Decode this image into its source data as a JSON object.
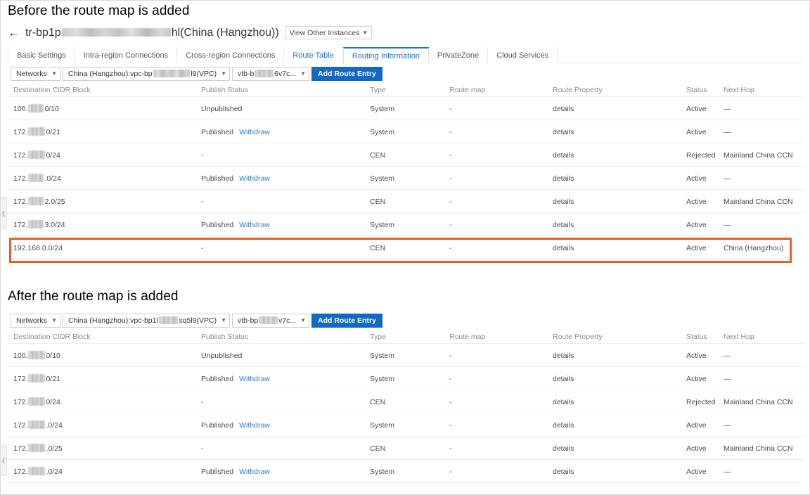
{
  "captions": {
    "before": "Before the route map is added",
    "after": "After the route map is added"
  },
  "header": {
    "back_icon": "arrow-left-icon",
    "title_prefix": "tr-bp1p",
    "title_suffix": "hl(China (Hangzhou))",
    "view_other_instances": "View Other Instances",
    "caret_icon": "chevron-down-icon"
  },
  "tabs": [
    {
      "label": "Basic Settings",
      "state": "normal"
    },
    {
      "label": "Intra-region Connections",
      "state": "normal"
    },
    {
      "label": "Cross-region Connections",
      "state": "normal"
    },
    {
      "label": "Route Table",
      "state": "link"
    },
    {
      "label": "Routing Information",
      "state": "active"
    },
    {
      "label": "PrivateZone",
      "state": "normal"
    },
    {
      "label": "Cloud Services",
      "state": "normal"
    }
  ],
  "filterbar_before": {
    "networks_select": "Networks",
    "vpc_select_prefix": "China (Hangzhou):vpc-bp",
    "vpc_select_suffix": "l9(VPC)",
    "vtb_select_prefix": "vtb-b",
    "vtb_select_suffix": "6v7c...",
    "add_route_entry": "Add Route Entry"
  },
  "filterbar_after": {
    "networks_select": "Networks",
    "vpc_select_prefix": "China (Hangzhou):vpc-bp1l",
    "vpc_select_suffix": "sq5l9(VPC)",
    "vtb_select_prefix": "vtb-bp",
    "vtb_select_suffix": "v7c...",
    "add_route_entry": "Add Route Entry"
  },
  "table_columns": {
    "cidr": "Destination CIDR Block",
    "publish": "Publish Status",
    "type": "Type",
    "route_map": "Route map",
    "route_property": "Route Property",
    "status": "Status",
    "next_hop": "Next Hop"
  },
  "colors": {
    "accent_blue": "#1268c3",
    "link_blue": "#2c7bd4",
    "highlight_orange": "#f05a28",
    "border_grey": "#ededed"
  },
  "table_before": {
    "rows": [
      {
        "cidr_prefix": "100.",
        "cidr_suffix": "0/10",
        "redact_w": 22,
        "publish": "Unpublished",
        "withdraw": "",
        "type": "System",
        "route_map": "-",
        "route_property": "details",
        "status": "Active",
        "next_hop": "—",
        "next_hop_link": true
      },
      {
        "cidr_prefix": "172.",
        "cidr_suffix": "0/21",
        "redact_w": 24,
        "publish": "Published",
        "withdraw": "Withdraw",
        "type": "System",
        "route_map": "-",
        "route_property": "details",
        "status": "Active",
        "next_hop": "—",
        "next_hop_link": true
      },
      {
        "cidr_prefix": "172.",
        "cidr_suffix": "0/24",
        "redact_w": 24,
        "publish": "-",
        "withdraw": "",
        "type": "CEN",
        "route_map": "-",
        "route_property": "details",
        "status": "Rejected",
        "next_hop": "Mainland China CCN",
        "next_hop_link": true
      },
      {
        "cidr_prefix": "172.",
        "cidr_suffix": ".0/24",
        "redact_w": 22,
        "publish": "Published",
        "withdraw": "Withdraw",
        "type": "System",
        "route_map": "-",
        "route_property": "details",
        "status": "Active",
        "next_hop": "—",
        "next_hop_link": true
      },
      {
        "cidr_prefix": "172.",
        "cidr_suffix": "2.0/25",
        "redact_w": 22,
        "publish": "-",
        "withdraw": "",
        "type": "CEN",
        "route_map": "-",
        "route_property": "details",
        "status": "Active",
        "next_hop": "Mainland China CCN",
        "next_hop_link": true
      },
      {
        "cidr_prefix": "172.",
        "cidr_suffix": "3.0/24",
        "redact_w": 22,
        "publish": "Published",
        "withdraw": "Withdraw",
        "type": "System",
        "route_map": "-",
        "route_property": "details",
        "status": "Active",
        "next_hop": "—",
        "next_hop_link": true
      },
      {
        "cidr_prefix": "192.168.0.0/24",
        "cidr_suffix": "",
        "redact_w": 0,
        "publish": "-",
        "withdraw": "",
        "type": "CEN",
        "route_map": "-",
        "route_property": "details",
        "status": "Active",
        "next_hop": "China (Hangzhou)",
        "next_hop_link": true,
        "highlighted": true
      }
    ]
  },
  "table_after": {
    "rows": [
      {
        "cidr_prefix": "100.",
        "cidr_suffix": "0/10",
        "redact_w": 24,
        "publish": "Unpublished",
        "withdraw": "",
        "type": "System",
        "route_map": "-",
        "route_property": "details",
        "status": "Active",
        "next_hop": "—",
        "next_hop_link": true
      },
      {
        "cidr_prefix": "172.",
        "cidr_suffix": "0/21",
        "redact_w": 24,
        "publish": "Published",
        "withdraw": "Withdraw",
        "type": "System",
        "route_map": "-",
        "route_property": "details",
        "status": "Active",
        "next_hop": "—",
        "next_hop_link": true
      },
      {
        "cidr_prefix": "172.",
        "cidr_suffix": "0/24",
        "redact_w": 24,
        "publish": "-",
        "withdraw": "",
        "type": "CEN",
        "route_map": "-",
        "route_property": "details",
        "status": "Rejected",
        "next_hop": "Mainland China CCN",
        "next_hop_link": true
      },
      {
        "cidr_prefix": "172.",
        "cidr_suffix": ".0/24",
        "redact_w": 24,
        "publish": "Published",
        "withdraw": "Withdraw",
        "type": "System",
        "route_map": "-",
        "route_property": "details",
        "status": "Active",
        "next_hop": "—",
        "next_hop_link": true
      },
      {
        "cidr_prefix": "172.",
        "cidr_suffix": ".0/25",
        "redact_w": 24,
        "publish": "-",
        "withdraw": "",
        "type": "CEN",
        "route_map": "-",
        "route_property": "details",
        "status": "Active",
        "next_hop": "Mainland China CCN",
        "next_hop_link": true
      },
      {
        "cidr_prefix": "172.",
        "cidr_suffix": ".0/24",
        "redact_w": 24,
        "publish": "Published",
        "withdraw": "Withdraw",
        "type": "System",
        "route_map": "-",
        "route_property": "details",
        "status": "Active",
        "next_hop": "—",
        "next_hop_link": true
      }
    ]
  },
  "collapse_handle_icon": "chevron-left-icon"
}
